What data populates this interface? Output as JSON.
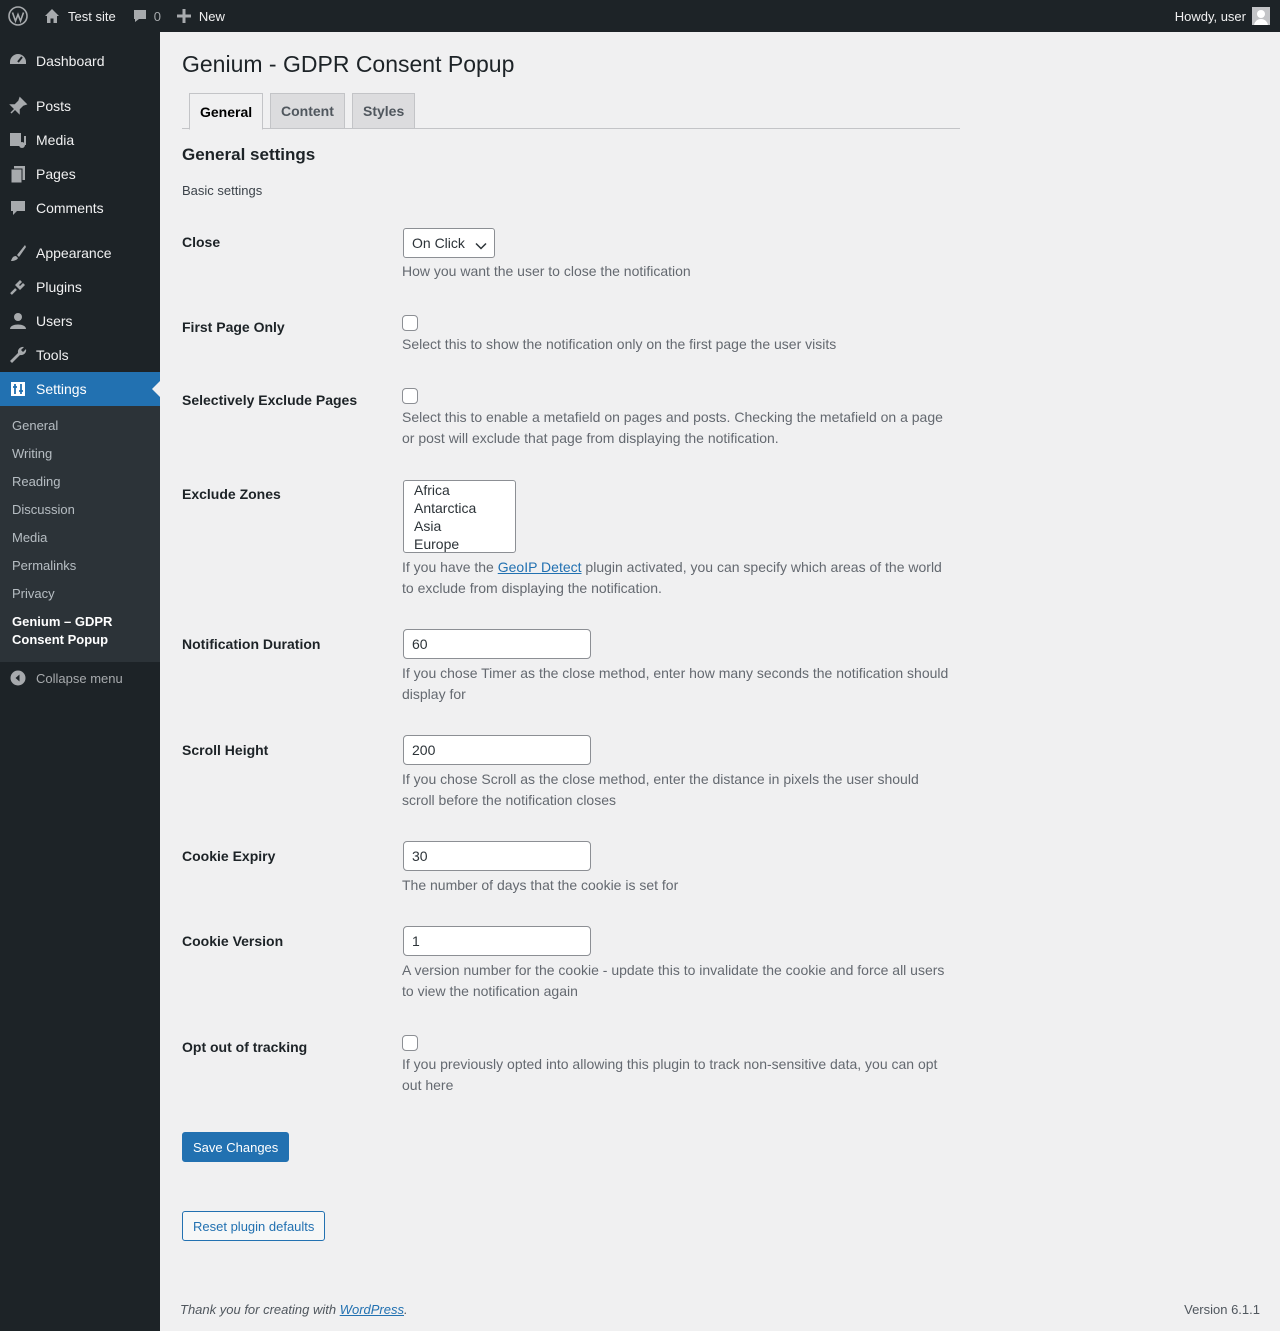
{
  "admin_bar": {
    "site_name": "Test site",
    "comments_count": "0",
    "new_label": "New",
    "greeting": "Howdy, user"
  },
  "sidebar": {
    "items": [
      {
        "label": "Dashboard",
        "icon": "dashboard-icon"
      },
      {
        "label": "Posts",
        "icon": "pin-icon"
      },
      {
        "label": "Media",
        "icon": "media-icon"
      },
      {
        "label": "Pages",
        "icon": "pages-icon"
      },
      {
        "label": "Comments",
        "icon": "comment-icon"
      },
      {
        "label": "Appearance",
        "icon": "brush-icon"
      },
      {
        "label": "Plugins",
        "icon": "plugin-icon"
      },
      {
        "label": "Users",
        "icon": "user-icon"
      },
      {
        "label": "Tools",
        "icon": "wrench-icon"
      },
      {
        "label": "Settings",
        "icon": "settings-icon"
      }
    ],
    "submenu": [
      "General",
      "Writing",
      "Reading",
      "Discussion",
      "Media",
      "Permalinks",
      "Privacy",
      "Genium – GDPR Consent Popup"
    ],
    "collapse_label": "Collapse menu"
  },
  "page": {
    "title": "Genium - GDPR Consent Popup",
    "tabs": [
      "General",
      "Content",
      "Styles"
    ],
    "section_title": "General settings",
    "section_subtitle": "Basic settings"
  },
  "fields": {
    "close": {
      "label": "Close",
      "value": "On Click",
      "desc": "How you want the user to close the notification"
    },
    "first_page_only": {
      "label": "First Page Only",
      "checked": false,
      "desc": "Select this to show the notification only on the first page the user visits"
    },
    "exclude_pages": {
      "label": "Selectively Exclude Pages",
      "checked": false,
      "desc": "Select this to enable a metafield on pages and posts. Checking the metafield on a page or post will exclude that page from displaying the notification."
    },
    "exclude_zones": {
      "label": "Exclude Zones",
      "options": [
        "Africa",
        "Antarctica",
        "Asia",
        "Europe"
      ],
      "desc_before": "If you have the ",
      "desc_link": "GeoIP Detect",
      "desc_after": " plugin activated, you can specify which areas of the world to exclude from displaying the notification."
    },
    "notification_duration": {
      "label": "Notification Duration",
      "value": "60",
      "desc": "If you chose Timer as the close method, enter how many seconds the notification should display for"
    },
    "scroll_height": {
      "label": "Scroll Height",
      "value": "200",
      "desc": "If you chose Scroll as the close method, enter the distance in pixels the user should scroll before the notification closes"
    },
    "cookie_expiry": {
      "label": "Cookie Expiry",
      "value": "30",
      "desc": "The number of days that the cookie is set for"
    },
    "cookie_version": {
      "label": "Cookie Version",
      "value": "1",
      "desc": "A version number for the cookie - update this to invalidate the cookie and force all users to view the notification again"
    },
    "opt_out": {
      "label": "Opt out of tracking",
      "checked": false,
      "desc": "If you previously opted into allowing this plugin to track non-sensitive data, you can opt out here"
    }
  },
  "buttons": {
    "save": "Save Changes",
    "reset": "Reset plugin defaults"
  },
  "footer": {
    "thanks_before": "Thank you for creating with ",
    "thanks_link": "WordPress",
    "thanks_after": ".",
    "version": "Version 6.1.1"
  },
  "colors": {
    "admin_bar": "#1d2327",
    "sidebar": "#1d2327",
    "submenu": "#2c3338",
    "accent": "#2271b1",
    "background": "#f0f0f1"
  }
}
